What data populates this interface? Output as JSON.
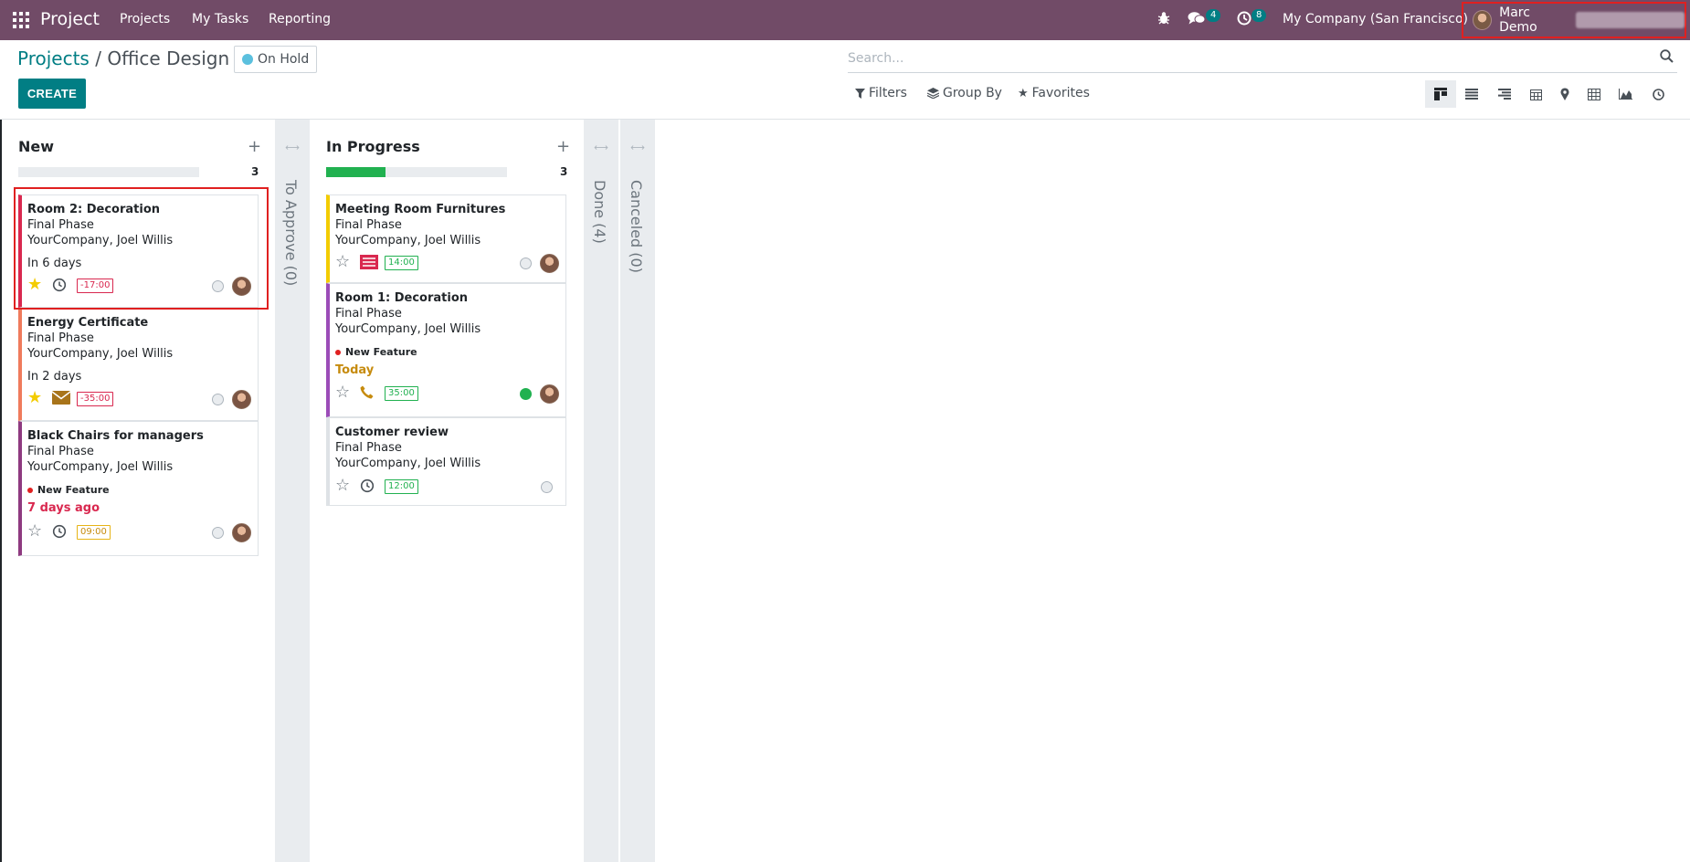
{
  "navbar": {
    "app_name": "Project",
    "menus": [
      "Projects",
      "My Tasks",
      "Reporting"
    ],
    "messages_count": "4",
    "activities_count": "8",
    "company": "My Company (San Francisco)",
    "user": "Marc Demo"
  },
  "control_panel": {
    "breadcrumb_parent": "Projects",
    "breadcrumb_separator": "/",
    "breadcrumb_current": "Office Design",
    "status": "On Hold",
    "create_label": "CREATE",
    "search_placeholder": "Search...",
    "filters_label": "Filters",
    "groupby_label": "Group By",
    "favorites_label": "Favorites"
  },
  "columns": [
    {
      "title": "New",
      "count": "3",
      "progress": 0,
      "cards": [
        {
          "title": "Room 2: Decoration",
          "phase": "Final Phase",
          "company": "YourCompany, Joel Willis",
          "deadline": "In 6 days",
          "starred": true,
          "activity_icon": "clock-icon",
          "time": "-17:00"
        },
        {
          "title": "Energy Certificate",
          "phase": "Final Phase",
          "company": "YourCompany, Joel Willis",
          "deadline": "In 2 days",
          "starred": true,
          "activity_icon": "envelope-icon",
          "time": "-35:00"
        },
        {
          "title": "Black Chairs for managers",
          "phase": "Final Phase",
          "company": "YourCompany, Joel Willis",
          "tag": "New Feature",
          "deadline": "7 days ago",
          "starred": false,
          "activity_icon": "clock-icon",
          "time": "09:00"
        }
      ]
    },
    {
      "title": "To Approve (0)",
      "folded": true
    },
    {
      "title": "In Progress",
      "count": "3",
      "progress": 0.33,
      "cards": [
        {
          "title": "Meeting Room Furnitures",
          "phase": "Final Phase",
          "company": "YourCompany, Joel Willis",
          "starred": false,
          "activity_icon": "invoice-icon",
          "time": "14:00"
        },
        {
          "title": "Room 1: Decoration",
          "phase": "Final Phase",
          "company": "YourCompany, Joel Willis",
          "tag": "New Feature",
          "deadline": "Today",
          "starred": false,
          "activity_icon": "phone-icon",
          "time": "35:00"
        },
        {
          "title": "Customer review",
          "phase": "Final Phase",
          "company": "YourCompany, Joel Willis",
          "starred": false,
          "activity_icon": "clock-icon",
          "time": "12:00"
        }
      ]
    },
    {
      "title": "Done (4)",
      "folded": true
    },
    {
      "title": "Canceled (0)",
      "folded": true
    }
  ],
  "colors": {
    "navbar": "#714B67",
    "accent": "#017e84",
    "progress_done": "#21b150",
    "overdue": "#d9284f",
    "today": "#c68b0e",
    "star": "#f3cc00"
  }
}
